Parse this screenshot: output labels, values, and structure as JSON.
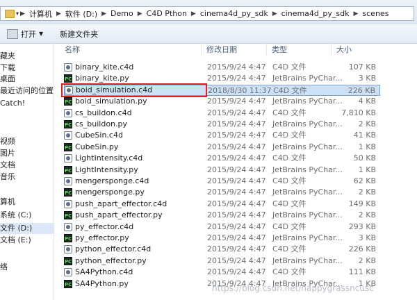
{
  "address": {
    "crumbs": [
      "计算机",
      "软件 (D:)",
      "Demo",
      "C4D Pthon",
      "cinema4d_py_sdk",
      "cinema4d_py_sdk",
      "scenes"
    ]
  },
  "toolbar": {
    "open_label": "打开",
    "new_folder_label": "新建文件夹"
  },
  "nav": {
    "items": [
      "藏夹",
      "下载",
      "桌面",
      "最近访问的位置",
      "Catch!",
      "视频",
      "图片",
      "文档",
      "音乐",
      "算机",
      "系统 (C:)",
      "文件 (D:)",
      "文档 (E:)",
      "络"
    ]
  },
  "columns": {
    "name": "名称",
    "date": "修改日期",
    "type": "类型",
    "size": "大小"
  },
  "files": [
    {
      "name": "binary_kite.c4d",
      "date": "2015/9/24 4:47",
      "type": "C4D 文件",
      "size": "107 KB",
      "kind": "c4d"
    },
    {
      "name": "binary_kite.py",
      "date": "2015/9/24 4:47",
      "type": "JetBrains PyChar...",
      "size": "3 KB",
      "kind": "py"
    },
    {
      "name": "boid_simulation.c4d",
      "date": "2018/8/30 11:37",
      "type": "C4D 文件",
      "size": "226 KB",
      "kind": "c4d"
    },
    {
      "name": "boid_simulation.py",
      "date": "2015/9/24 4:47",
      "type": "JetBrains PyChar...",
      "size": "4 KB",
      "kind": "py"
    },
    {
      "name": "cs_buildon.c4d",
      "date": "2015/9/24 4:47",
      "type": "C4D 文件",
      "size": "7,810 KB",
      "kind": "c4d"
    },
    {
      "name": "cs_buildon.py",
      "date": "2015/9/24 4:47",
      "type": "JetBrains PyChar...",
      "size": "2 KB",
      "kind": "py"
    },
    {
      "name": "CubeSin.c4d",
      "date": "2015/9/24 4:47",
      "type": "C4D 文件",
      "size": "41 KB",
      "kind": "c4d"
    },
    {
      "name": "CubeSin.py",
      "date": "2015/9/24 4:47",
      "type": "JetBrains PyChar...",
      "size": "1 KB",
      "kind": "py"
    },
    {
      "name": "LightIntensity.c4d",
      "date": "2015/9/24 4:47",
      "type": "C4D 文件",
      "size": "50 KB",
      "kind": "c4d"
    },
    {
      "name": "LightIntensity.py",
      "date": "2015/9/24 4:47",
      "type": "JetBrains PyChar...",
      "size": "1 KB",
      "kind": "py"
    },
    {
      "name": "mengersponge.c4d",
      "date": "2015/9/24 4:47",
      "type": "C4D 文件",
      "size": "62 KB",
      "kind": "c4d"
    },
    {
      "name": "mengersponge.py",
      "date": "2015/9/24 4:47",
      "type": "JetBrains PyChar...",
      "size": "2 KB",
      "kind": "py"
    },
    {
      "name": "push_apart_effector.c4d",
      "date": "2015/9/24 4:47",
      "type": "C4D 文件",
      "size": "149 KB",
      "kind": "c4d"
    },
    {
      "name": "push_apart_effector.py",
      "date": "2015/9/24 4:47",
      "type": "JetBrains PyChar...",
      "size": "2 KB",
      "kind": "py"
    },
    {
      "name": "py_effector.c4d",
      "date": "2015/9/24 4:47",
      "type": "C4D 文件",
      "size": "293 KB",
      "kind": "c4d"
    },
    {
      "name": "py_effector.py",
      "date": "2015/9/24 4:47",
      "type": "JetBrains PyChar...",
      "size": "3 KB",
      "kind": "py"
    },
    {
      "name": "python_effector.c4d",
      "date": "2015/9/24 4:47",
      "type": "C4D 文件",
      "size": "226 KB",
      "kind": "c4d"
    },
    {
      "name": "python_effector.py",
      "date": "2015/9/24 4:47",
      "type": "JetBrains PyChar...",
      "size": "2 KB",
      "kind": "py"
    },
    {
      "name": "SA4Python.c4d",
      "date": "2015/9/24 4:47",
      "type": "C4D 文件",
      "size": "111 KB",
      "kind": "c4d"
    },
    {
      "name": "SA4Python.py",
      "date": "2015/9/24 4:47",
      "type": "JetBrains PyChar...",
      "size": "1 KB",
      "kind": "py"
    }
  ],
  "selected_index": 2,
  "watermark": "https://blog.csdn.net/happygrassncusc"
}
